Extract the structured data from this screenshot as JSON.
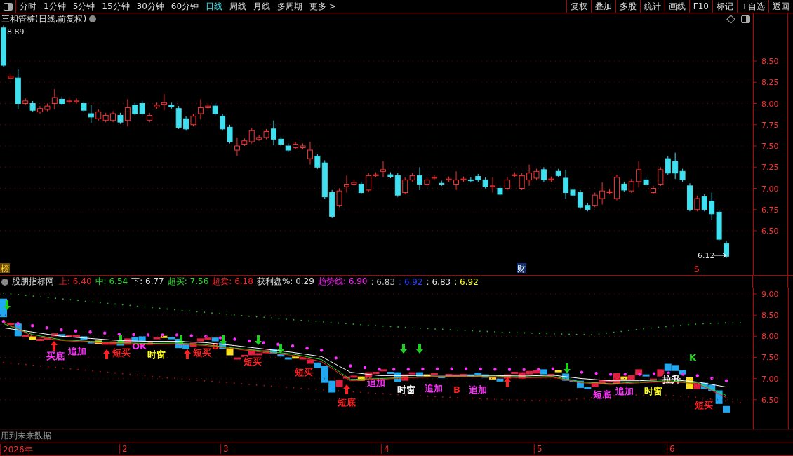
{
  "toolbar": {
    "periods": [
      {
        "label": "分时",
        "selected": false
      },
      {
        "label": "1分钟",
        "selected": false
      },
      {
        "label": "5分钟",
        "selected": false
      },
      {
        "label": "15分钟",
        "selected": false
      },
      {
        "label": "30分钟",
        "selected": false
      },
      {
        "label": "60分钟",
        "selected": false
      },
      {
        "label": "日线",
        "selected": true
      },
      {
        "label": "周线",
        "selected": false
      },
      {
        "label": "月线",
        "selected": false
      },
      {
        "label": "多周期",
        "selected": false
      },
      {
        "label": "更多 >",
        "selected": false
      }
    ],
    "actions": [
      "复权",
      "叠加",
      "多股",
      "统计",
      "画线",
      "F10",
      "标记",
      "+自选",
      "返回"
    ]
  },
  "main_chart": {
    "title": "三和管桩(日线,前复权)",
    "high_label": "8.89",
    "low_label": "6.12",
    "markers": [
      {
        "text": "榜",
        "kind": "badge"
      },
      {
        "text": "财",
        "kind": "note"
      },
      {
        "text": "S",
        "kind": "signal"
      }
    ],
    "y_axis": [
      "8.50",
      "8.25",
      "8.00",
      "7.75",
      "7.50",
      "7.25",
      "7.00",
      "6.75",
      "6.50"
    ]
  },
  "indicator": {
    "name": "股朋指标网",
    "values": [
      {
        "text": "上: 6.40",
        "color": "#ff2020"
      },
      {
        "text": "中: 6.54",
        "color": "#20e020"
      },
      {
        "text": "下: 6.77",
        "color": "#e0e0e0"
      },
      {
        "text": "超买: 7.56",
        "color": "#20e020"
      },
      {
        "text": "超卖: 6.18",
        "color": "#ff2020"
      },
      {
        "text": "获利盘%: 0.29",
        "color": "#e0e0e0"
      },
      {
        "text": "趋势线: 6.90",
        "color": "#ff20ff"
      },
      {
        "text": ": 6.83",
        "color": "#c0c0c0"
      },
      {
        "text": ": 6.92",
        "color": "#2040ff"
      },
      {
        "text": ": 6.83",
        "color": "#e0e0e0"
      },
      {
        "text": ": 6.92",
        "color": "#ffff20"
      }
    ],
    "signals": [
      {
        "text": "买底",
        "color": "#ff30ff"
      },
      {
        "text": "追加",
        "color": "#ff30ff"
      },
      {
        "text": "短买",
        "color": "#ff2020"
      },
      {
        "text": "OK",
        "color": "#ff30ff"
      },
      {
        "text": "时窗",
        "color": "#ffff20"
      },
      {
        "text": "短买",
        "color": "#ff2020"
      },
      {
        "text": "B",
        "color": "#ff2020"
      },
      {
        "text": "短买",
        "color": "#ff2020"
      },
      {
        "text": "短买",
        "color": "#ff2020"
      },
      {
        "text": "短底",
        "color": "#ff2020"
      },
      {
        "text": "追加",
        "color": "#ff30ff"
      },
      {
        "text": "时窗",
        "color": "#ffffff"
      },
      {
        "text": "追加",
        "color": "#ff30ff"
      },
      {
        "text": "B",
        "color": "#ff2020"
      },
      {
        "text": "追加",
        "color": "#ff30ff"
      },
      {
        "text": "短底",
        "color": "#ff30ff"
      },
      {
        "text": "追加",
        "color": "#ff30ff"
      },
      {
        "text": "时窗",
        "color": "#ffff20"
      },
      {
        "text": "拉升",
        "color": "#ffffff"
      },
      {
        "text": "K",
        "color": "#20e020"
      },
      {
        "text": "短买",
        "color": "#ff2020"
      }
    ],
    "chart_data": {
      "type": "line",
      "grid": true,
      "ylim": [
        5.8,
        9.15
      ],
      "yticks": [
        {
          "value": 9,
          "label": "9.00"
        },
        {
          "value": 8.5,
          "label": "8.50"
        },
        {
          "value": 8,
          "label": "8.00"
        },
        {
          "value": 7.5,
          "label": "7.50"
        },
        {
          "value": 7,
          "label": "7.00"
        },
        {
          "value": 6.5,
          "label": "6.50"
        }
      ],
      "series": [
        {
          "color": "#ffffff",
          "values": [
            8.2,
            8.1,
            8.0,
            7.95,
            7.9,
            7.88,
            7.88,
            7.85,
            7.78,
            7.7,
            7.62,
            7.52,
            7.15,
            7.07,
            7.07,
            7.08,
            7.08,
            7.07,
            7.06,
            7.08,
            7.0,
            6.95,
            6.95,
            6.98,
            6.92,
            6.8
          ]
        },
        {
          "color": "#20e020",
          "values": [
            8.3,
            8.04,
            7.92,
            7.88,
            7.85,
            7.83,
            7.84,
            7.8,
            7.72,
            7.65,
            7.58,
            7.45,
            6.98,
            7.0,
            7.03,
            7.05,
            7.05,
            7.06,
            7.03,
            7.05,
            6.92,
            6.88,
            6.92,
            6.95,
            6.9,
            6.6
          ]
        },
        {
          "color": "#ff2020",
          "values": [
            8.35,
            8.0,
            7.9,
            7.86,
            7.83,
            7.81,
            7.82,
            7.78,
            7.7,
            7.62,
            7.55,
            7.4,
            6.95,
            6.98,
            7.02,
            7.04,
            7.04,
            7.03,
            7.02,
            7.03,
            6.9,
            6.86,
            6.9,
            6.93,
            6.88,
            6.55
          ]
        }
      ]
    }
  },
  "note": "用到未来数据",
  "x_axis": [
    "2026年",
    "2",
    "3",
    "4",
    "5",
    "6"
  ]
}
